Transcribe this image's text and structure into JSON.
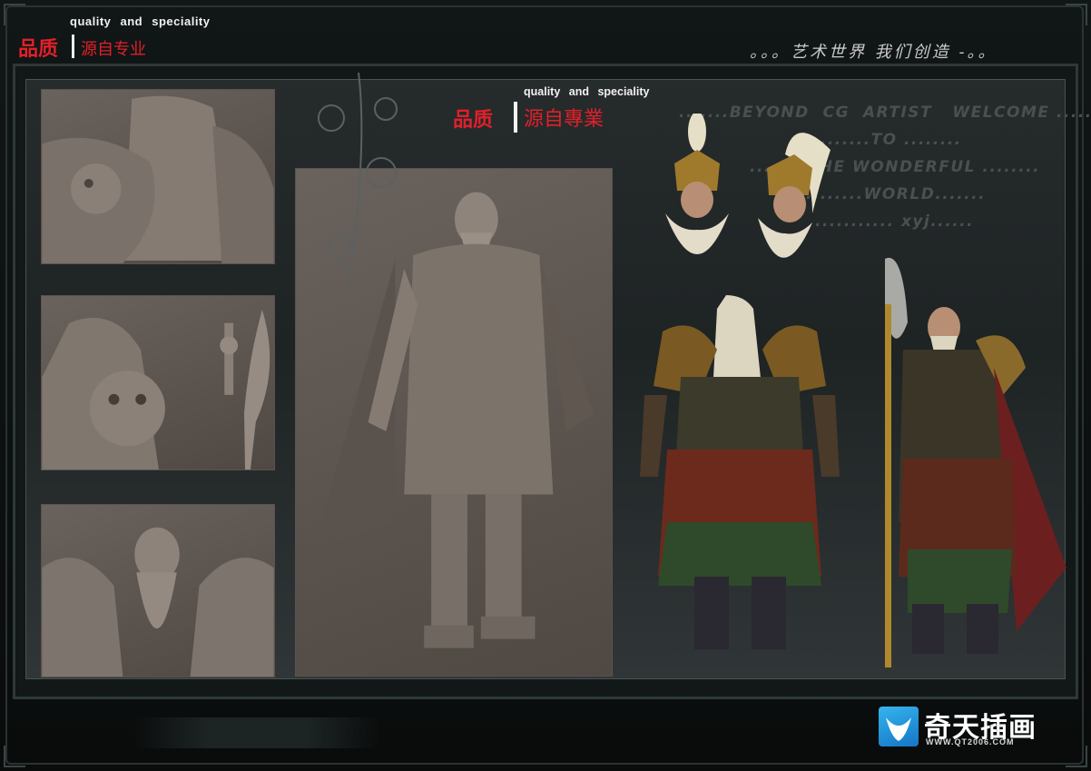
{
  "header": {
    "title_en": "quality and speciality",
    "title_cn_primary": "品质",
    "title_cn_secondary": "源自专业",
    "slogan": "。。。艺术世界  我们创造  -。。"
  },
  "subheader": {
    "title_en": "quality and speciality",
    "title_cn_primary": "品质",
    "title_cn_secondary": "源自專業"
  },
  "background_text": {
    "line1": ".......BEYOND  CG  ARTIST   WELCOME ..........",
    "line2": "..........TO ........",
    "line3": "........THE WONDERFUL ........",
    "line4": "..........WORLD.......",
    "line5": "........... xyj......"
  },
  "logo": {
    "name": "奇天插画",
    "url": "WWW.QT2006.COM"
  },
  "colors": {
    "accent_red": "#e0202a",
    "clay": "#6a625c",
    "logo_blue": "#1e8fd8"
  }
}
